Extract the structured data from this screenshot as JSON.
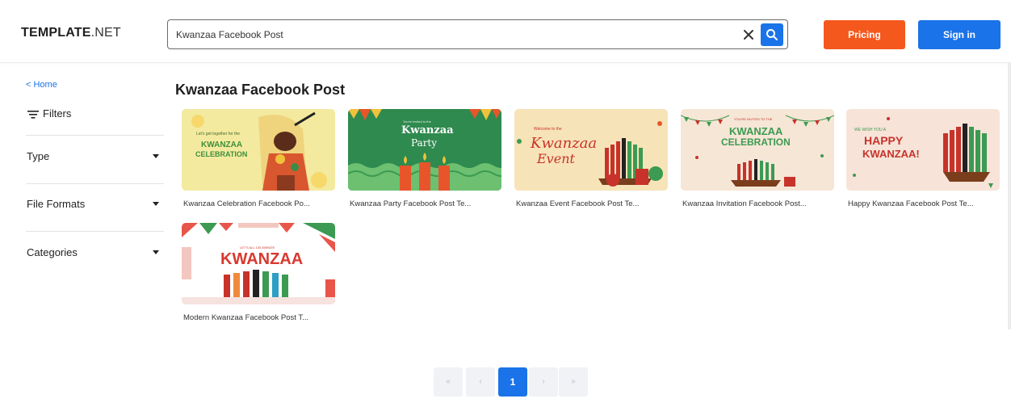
{
  "header": {
    "logo_bold": "TEMPLATE",
    "logo_thin": ".NET",
    "search_value": "Kwanzaa Facebook Post",
    "pricing_label": "Pricing",
    "signin_label": "Sign in"
  },
  "sidebar": {
    "home_link": "< Home",
    "filters_label": "Filters",
    "facets": [
      "Type",
      "File Formats",
      "Categories"
    ]
  },
  "main": {
    "title": "Kwanzaa Facebook Post",
    "cards": [
      {
        "title": "Kwanzaa Celebration Facebook Po...",
        "thumb_small": "Let's get together for the",
        "thumb_line1": "KWANZAA",
        "thumb_line2": "CELEBRATION"
      },
      {
        "title": "Kwanzaa Party Facebook Post Te...",
        "thumb_small": "You're invited to the",
        "thumb_line1": "Kwanzaa",
        "thumb_line2": "Party"
      },
      {
        "title": "Kwanzaa Event Facebook Post Te...",
        "thumb_small": "Welcome to the",
        "thumb_line1": "Kwanzaa",
        "thumb_line2": "Event"
      },
      {
        "title": "Kwanzaa Invitation Facebook Post...",
        "thumb_small": "YOU'RE INVITED TO THE",
        "thumb_line1": "KWANZAA",
        "thumb_line2": "CELEBRATION"
      },
      {
        "title": "Happy Kwanzaa Facebook Post Te...",
        "thumb_small": "WE WISH YOU A",
        "thumb_line1": "HAPPY",
        "thumb_line2": "KWANZAA!"
      },
      {
        "title": "Modern Kwanzaa Facebook Post T...",
        "thumb_small": "LET'S ALL CELEBRATE",
        "thumb_line1": "KWANZAA",
        "thumb_line2": ""
      }
    ]
  },
  "pagination": {
    "first": "«",
    "prev": "‹",
    "current": "1",
    "next": "›",
    "last": "»"
  },
  "colors": {
    "accent_blue": "#1a73e8",
    "pricing_orange": "#f5581d"
  }
}
